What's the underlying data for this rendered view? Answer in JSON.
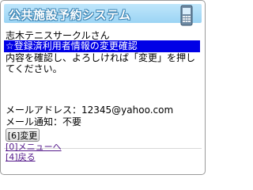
{
  "header": {
    "title": "公共施設予約システム",
    "icon": "mobile-phone-icon"
  },
  "greeting": "志木テニスサークルさん",
  "section_title": "☆登録済利用者情報の変更確認",
  "instruction": "内容を確認し、よろしければ「変更」を押してください。",
  "fields": {
    "mail": "メールアドレス：12345@yahoo.com",
    "notify": "メール通知：不要"
  },
  "change_button": "[6]変更",
  "links": {
    "menu": "[0]メニューへ",
    "back": "[4]戻る"
  },
  "colors": {
    "header_bg": "#9bd4f4",
    "section_bg": "#0000e6",
    "link": "#551a8b"
  }
}
